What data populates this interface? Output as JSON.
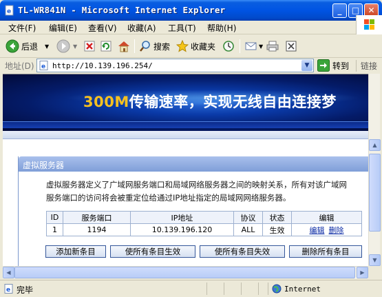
{
  "window": {
    "title": "TL-WR841N - Microsoft Internet Explorer"
  },
  "menu": {
    "items": [
      "文件(F)",
      "编辑(E)",
      "查看(V)",
      "收藏(A)",
      "工具(T)",
      "帮助(H)"
    ]
  },
  "toolbar": {
    "back_label": "后退",
    "search_label": "搜索",
    "favorites_label": "收藏夹"
  },
  "address": {
    "label": "地址(D)",
    "url": "http://10.139.196.254/",
    "go_label": "转到",
    "links_label": "链接"
  },
  "banner": {
    "highlight": "300M",
    "text": "传输速率，实现无线自由连接梦"
  },
  "virtual_server": {
    "title": "虚拟服务器",
    "desc_line1": "虚拟服务器定义了广域网服务端口和局域网络服务器之间的映射关系，所有对该广域网",
    "desc_line2": "服务端口的访问将会被重定位给通过IP地址指定的局域网网络服务器。",
    "columns": [
      "ID",
      "服务端口",
      "IP地址",
      "协议",
      "状态",
      "编辑"
    ],
    "rows": [
      {
        "id": "1",
        "port": "1194",
        "ip": "10.139.196.120",
        "protocol": "ALL",
        "status": "生效",
        "edit": "编辑",
        "delete": "删除"
      }
    ],
    "buttons": {
      "add": "添加新条目",
      "enable_all": "使所有条目生效",
      "disable_all": "使所有条目失效",
      "delete_all": "删除所有条目"
    }
  },
  "status": {
    "text": "完毕",
    "zone": "Internet"
  }
}
